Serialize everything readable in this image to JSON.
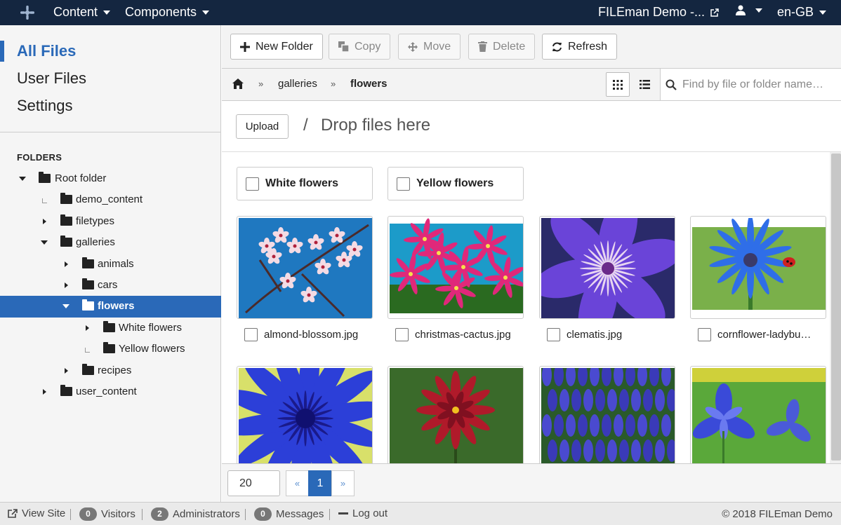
{
  "topbar": {
    "menu_content": "Content",
    "menu_components": "Components",
    "site_name": "FILEman Demo -...",
    "language": "en-GB"
  },
  "sidebar": {
    "nav": [
      {
        "label": "All Files",
        "active": true
      },
      {
        "label": "User Files",
        "active": false
      },
      {
        "label": "Settings",
        "active": false
      }
    ],
    "folders_heading": "FOLDERS",
    "tree": [
      {
        "label": "Root folder",
        "level": 0,
        "state": "open"
      },
      {
        "label": "demo_content",
        "level": 1,
        "state": "leaf"
      },
      {
        "label": "filetypes",
        "level": 1,
        "state": "closed"
      },
      {
        "label": "galleries",
        "level": 1,
        "state": "open"
      },
      {
        "label": "animals",
        "level": 2,
        "state": "closed"
      },
      {
        "label": "cars",
        "level": 2,
        "state": "closed"
      },
      {
        "label": "flowers",
        "level": 2,
        "state": "open",
        "selected": true
      },
      {
        "label": "White flowers",
        "level": 3,
        "state": "closed"
      },
      {
        "label": "Yellow flowers",
        "level": 3,
        "state": "leaf"
      },
      {
        "label": "recipes",
        "level": 2,
        "state": "closed"
      },
      {
        "label": "user_content",
        "level": 1,
        "state": "closed"
      }
    ]
  },
  "toolbar": {
    "new_folder": "New Folder",
    "copy": "Copy",
    "move": "Move",
    "delete": "Delete",
    "refresh": "Refresh"
  },
  "breadcrumb": {
    "galleries": "galleries",
    "flowers": "flowers"
  },
  "search": {
    "placeholder": "Find by file or folder name…"
  },
  "upload": {
    "button": "Upload",
    "separator": "/",
    "drop_text": "Drop files here"
  },
  "subfolders": [
    "White flowers",
    "Yellow flowers"
  ],
  "files": [
    {
      "name": "almond-blossom.jpg",
      "thumb": "almond-blossom"
    },
    {
      "name": "christmas-cactus.jpg",
      "thumb": "christmas-cactus"
    },
    {
      "name": "clematis.jpg",
      "thumb": "clematis"
    },
    {
      "name": "cornflower-ladybu…",
      "thumb": "cornflower-ladybug"
    },
    {
      "name": "",
      "thumb": "cornflower"
    },
    {
      "name": "",
      "thumb": "dahlia"
    },
    {
      "name": "",
      "thumb": "grape-hyacinth"
    },
    {
      "name": "",
      "thumb": "iris"
    }
  ],
  "pagination": {
    "limit": "20",
    "prev": "«",
    "current": "1",
    "next": "»"
  },
  "status": {
    "view_site": "View Site",
    "visitors_count": "0",
    "visitors": "Visitors",
    "admins_count": "2",
    "admins": "Administrators",
    "messages_count": "0",
    "messages": "Messages",
    "logout": "Log out",
    "copyright": "© 2018 FILEman Demo"
  },
  "colors": {
    "topbar": "#142640",
    "accent": "#2a69b8"
  }
}
